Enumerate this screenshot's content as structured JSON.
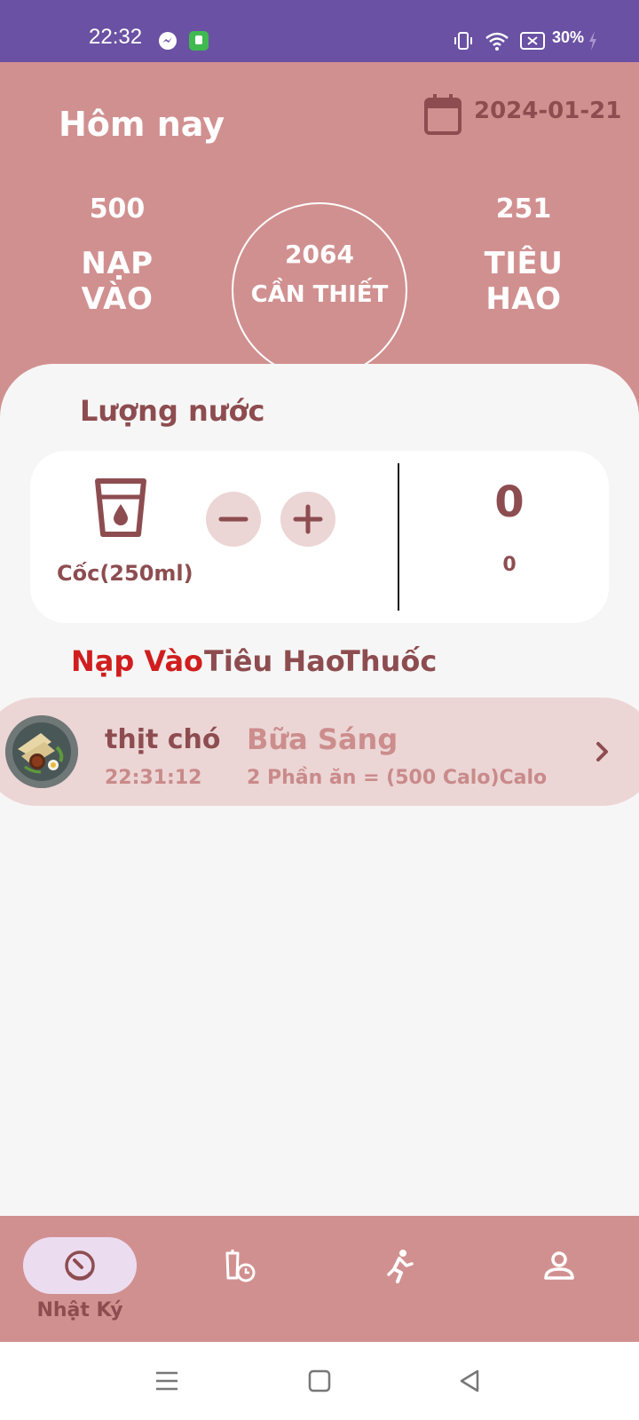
{
  "status_bar": {
    "time": "22:32",
    "battery": "30%",
    "icons": [
      "messenger-icon",
      "app-notification-icon",
      "vibrate-icon",
      "wifi-icon",
      "battery-saver-icon",
      "charging-icon"
    ]
  },
  "header": {
    "title": "Hôm nay",
    "date": "2024-01-21",
    "intake": {
      "value": "500",
      "label": "NẠP VÀO"
    },
    "required": {
      "value": "2064",
      "label": "CẦN THIẾT"
    },
    "burned": {
      "value": "251",
      "label": "TIÊU HAO"
    }
  },
  "water": {
    "title": "Lượng nước",
    "cup_label": "Cốc(250ml)",
    "count": "0",
    "amount": "0"
  },
  "tabs": [
    "Nạp Vào",
    "Tiêu Hao",
    "Thuốc"
  ],
  "entries": [
    {
      "name": "thịt chó",
      "time": "22:31:12",
      "meal": "Bữa Sáng",
      "detail": "2 Phần ăn = (500 Calo)Calo"
    }
  ],
  "bottom_nav": {
    "items": [
      {
        "label": "Nhật Ký",
        "icon": "diary-gauge-icon",
        "active": true
      },
      {
        "label": "",
        "icon": "food-timer-icon",
        "active": false
      },
      {
        "label": "",
        "icon": "running-icon",
        "active": false
      },
      {
        "label": "",
        "icon": "profile-icon",
        "active": false
      }
    ]
  },
  "colors": {
    "status_bar": "#6a51a3",
    "header": "#d19090",
    "accent_text": "#8d4d50",
    "active_tab": "#d01e1e",
    "entry_bg": "#ecd5d5"
  }
}
